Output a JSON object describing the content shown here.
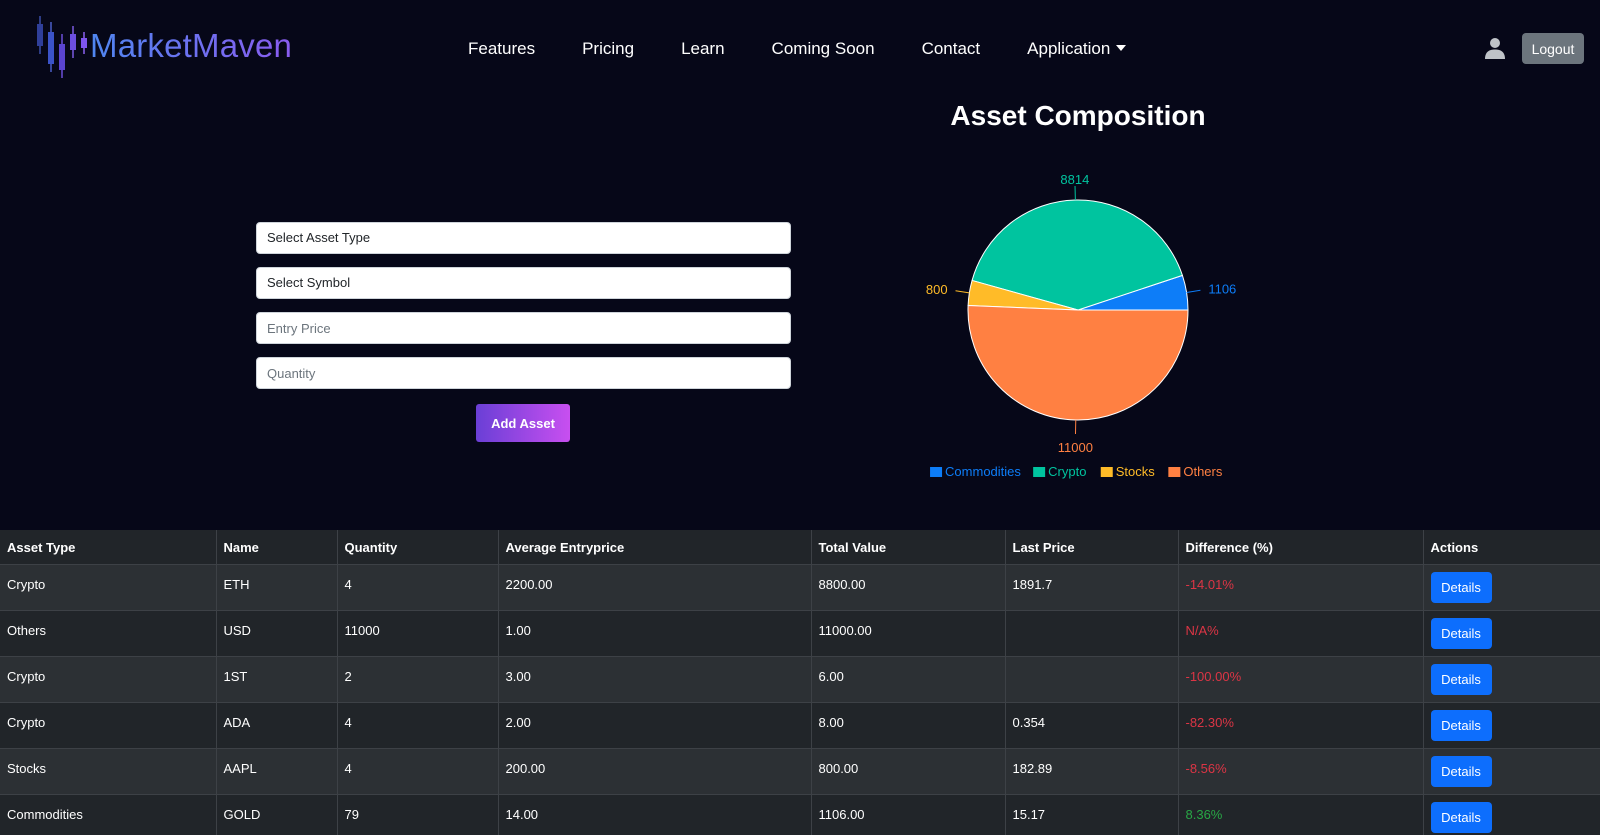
{
  "brand": {
    "name": "MarketMaven"
  },
  "nav": {
    "links": [
      "Features",
      "Pricing",
      "Learn",
      "Coming Soon",
      "Contact"
    ],
    "dropdown_label": "Application",
    "logout_label": "Logout"
  },
  "form": {
    "asset_type_placeholder": "Select Asset Type",
    "symbol_placeholder": "Select Symbol",
    "entry_price_placeholder": "Entry Price",
    "quantity_placeholder": "Quantity",
    "submit_label": "Add Asset"
  },
  "chart_data": {
    "type": "pie",
    "title": "Asset Composition",
    "categories": [
      "Commodities",
      "Crypto",
      "Stocks",
      "Others"
    ],
    "values": [
      1106,
      8814,
      800,
      11000
    ],
    "colors": [
      "#0d7df8",
      "#00c49f",
      "#ffbb28",
      "#ff8042"
    ],
    "legend_position": "bottom"
  },
  "table": {
    "headers": [
      "Asset Type",
      "Name",
      "Quantity",
      "Average Entryprice",
      "Total Value",
      "Last Price",
      "Difference (%)",
      "Actions"
    ],
    "action_label": "Details",
    "rows": [
      {
        "asset_type": "Crypto",
        "name": "ETH",
        "quantity": "4",
        "avg_entry": "2200.00",
        "total": "8800.00",
        "last": "1891.7",
        "diff": "-14.01%",
        "positive": false
      },
      {
        "asset_type": "Others",
        "name": "USD",
        "quantity": "11000",
        "avg_entry": "1.00",
        "total": "11000.00",
        "last": "",
        "diff": "N/A%",
        "positive": false
      },
      {
        "asset_type": "Crypto",
        "name": "1ST",
        "quantity": "2",
        "avg_entry": "3.00",
        "total": "6.00",
        "last": "",
        "diff": "-100.00%",
        "positive": false
      },
      {
        "asset_type": "Crypto",
        "name": "ADA",
        "quantity": "4",
        "avg_entry": "2.00",
        "total": "8.00",
        "last": "0.354",
        "diff": "-82.30%",
        "positive": false
      },
      {
        "asset_type": "Stocks",
        "name": "AAPL",
        "quantity": "4",
        "avg_entry": "200.00",
        "total": "800.00",
        "last": "182.89",
        "diff": "-8.56%",
        "positive": false
      },
      {
        "asset_type": "Commodities",
        "name": "GOLD",
        "quantity": "79",
        "avg_entry": "14.00",
        "total": "1106.00",
        "last": "15.17",
        "diff": "8.36%",
        "positive": true
      }
    ]
  }
}
